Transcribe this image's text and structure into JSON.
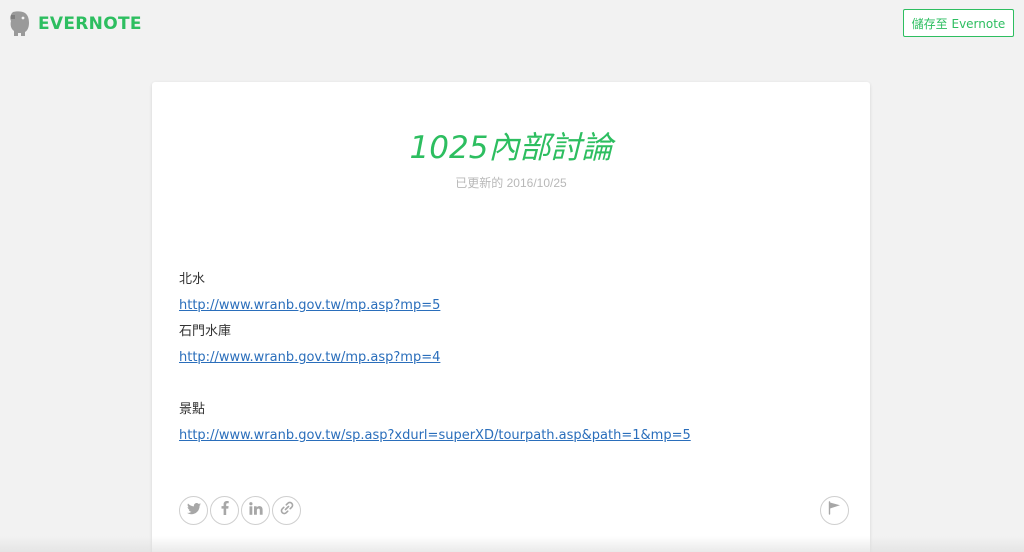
{
  "header": {
    "logo_text": "EVERNOTE",
    "save_button_label": "儲存至 Evernote"
  },
  "note": {
    "title": "1025內部討論",
    "updated": "已更新的 2016/10/25",
    "lines": [
      {
        "type": "text",
        "text": "北水"
      },
      {
        "type": "link",
        "text": "http://www.wranb.gov.tw/mp.asp?mp=5"
      },
      {
        "type": "text",
        "text": "石門水庫"
      },
      {
        "type": "link",
        "text": "http://www.wranb.gov.tw/mp.asp?mp=4"
      },
      {
        "type": "blank",
        "text": ""
      },
      {
        "type": "text",
        "text": "景點"
      },
      {
        "type": "link",
        "text": "http://www.wranb.gov.tw/sp.asp?xdurl=superXD/tourpath.asp&path=1&mp=5"
      }
    ]
  },
  "share": {
    "icons": [
      "twitter-icon",
      "facebook-icon",
      "linkedin-icon",
      "link-icon"
    ],
    "flag_icon": "flag-icon"
  },
  "colors": {
    "brand_green": "#2dbe60",
    "link_blue": "#2a6ebb",
    "background": "#f2f2f2"
  }
}
